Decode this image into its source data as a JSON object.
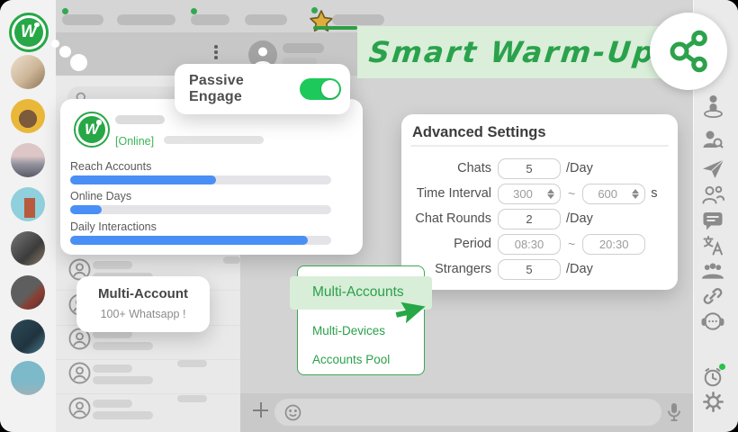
{
  "app": {
    "logo_letter": "W"
  },
  "colors": {
    "accent_green": "#2aa24b",
    "toggle_green": "#1ec95b",
    "banner_bg": "#daeeda",
    "dropdown_highlight": "#d8eed8",
    "progress_blue": "#4a8ff5",
    "star_gold": "#ddae3e"
  },
  "banner": {
    "title": "Smart Warm-Up"
  },
  "passive_card": {
    "label": "Passive Engage",
    "toggle_state": "on"
  },
  "profile_card": {
    "logo_letter": "W",
    "status": "[Online]",
    "metrics": [
      {
        "label": "Reach Accounts",
        "percent": 56
      },
      {
        "label": "Online Days",
        "percent": 12
      },
      {
        "label": "Daily Interactions",
        "percent": 91
      }
    ]
  },
  "advanced_settings": {
    "title": "Advanced Settings",
    "rows": [
      {
        "label": "Chats",
        "value": "5",
        "unit": "/Day"
      },
      {
        "label": "Time Interval",
        "value": "300",
        "tilde": "~",
        "value2": "600",
        "unit": "s"
      },
      {
        "label": "Chat Rounds",
        "value": "2",
        "unit": "/Day"
      },
      {
        "label": "Period",
        "value": "08:30",
        "tilde": "~",
        "value2": "20:30",
        "unit": ""
      },
      {
        "label": "Strangers",
        "value": "5",
        "unit": "/Day"
      }
    ]
  },
  "tooltip": {
    "title": "Multi-Account",
    "subtitle": "100+ Whatsapp !"
  },
  "dropdown": {
    "items": [
      {
        "label": "Multi-Accounts",
        "active": true
      },
      {
        "label": "Multi-Devices",
        "active": false
      },
      {
        "label": "Accounts Pool",
        "active": false
      }
    ]
  },
  "right_toolbar": {
    "icons": [
      "user-status",
      "contact-search",
      "send",
      "contacts",
      "chat-message",
      "translate",
      "group",
      "link",
      "support",
      "alarm-clock",
      "settings"
    ]
  },
  "left_bar": {
    "avatar_count": 8
  }
}
